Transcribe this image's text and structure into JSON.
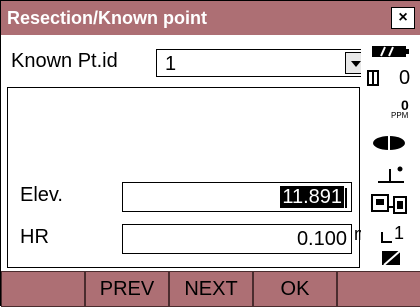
{
  "window": {
    "title": "Resection/Known point",
    "close_label": "×"
  },
  "known_point": {
    "label": "Known Pt.id",
    "value": "1"
  },
  "fields": [
    {
      "label": "Elev.",
      "value": "11.891",
      "unit": ""
    },
    {
      "label": "HR",
      "value": "0.100",
      "unit": "m"
    }
  ],
  "status": {
    "battery_icon": "battery-icon",
    "prism_const_value": "0",
    "ppm_value": "0",
    "ppm_label": "PPM",
    "target_icon": "prism-icon",
    "tilt_icon": "tilt-icon",
    "mode_icon": "instrument-icon",
    "input_mode": "1",
    "edit_icon": "keyboard-icon"
  },
  "softkeys": [
    "",
    "PREV",
    "NEXT",
    "OK",
    ""
  ]
}
